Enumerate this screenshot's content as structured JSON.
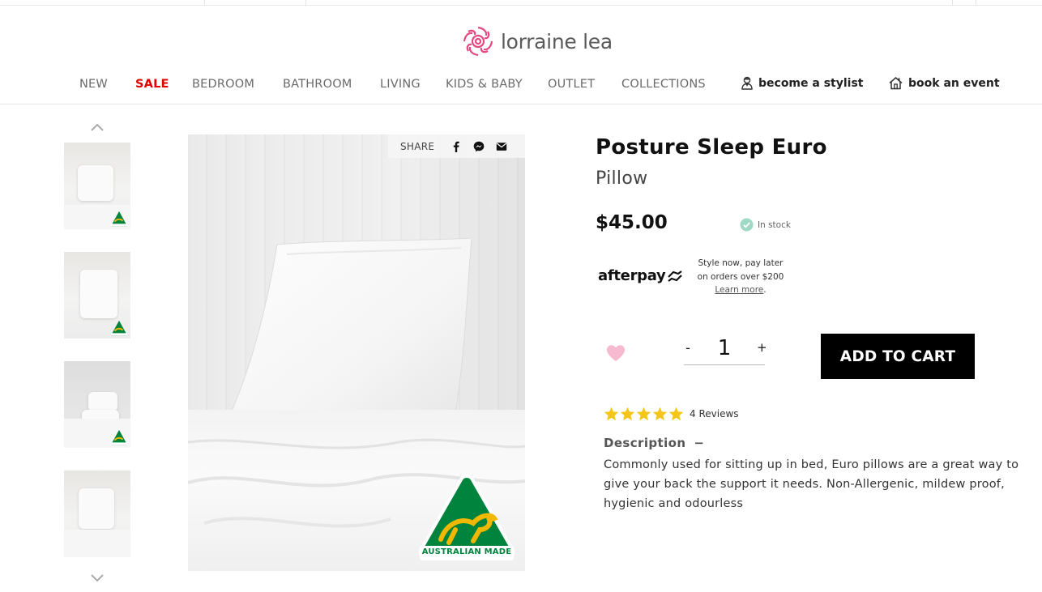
{
  "brand": {
    "name": "lorraine lea",
    "accent": "#e5467f"
  },
  "nav": {
    "items": [
      "NEW",
      "SALE",
      "BEDROOM",
      "BATHROOM",
      "LIVING",
      "KIDS & BABY",
      "OUTLET",
      "COLLECTIONS"
    ],
    "sale_color": "#e00000",
    "stylist_label": "become a stylist",
    "event_label": "book an event"
  },
  "gallery": {
    "up_icon": "chevron-up-icon",
    "down_icon": "chevron-down-icon",
    "badge_text": "AUSTRALIAN MADE"
  },
  "share": {
    "label": "SHARE",
    "icons": [
      "facebook-icon",
      "messenger-icon",
      "email-icon"
    ]
  },
  "product": {
    "title": "Posture Sleep Euro",
    "subtitle": "Pillow",
    "price": "$45.00",
    "stock": "In stock",
    "stock_color": "#9fd8c4"
  },
  "afterpay": {
    "logo": "afterpay",
    "line1": "Style now, pay later",
    "line2": "on orders over $200",
    "learn": "Learn more",
    "learn_suffix": "."
  },
  "purchase": {
    "minus": "-",
    "plus": "+",
    "quantity": "1",
    "cta": "ADD TO CART",
    "wishlist_color": "#f7b9cf"
  },
  "rating": {
    "stars": 5,
    "reviews": "4 Reviews",
    "star_color": "#f5c518"
  },
  "description": {
    "heading": "Description",
    "toggle": "−",
    "body": "Commonly used for sitting up in bed, Euro pillows are a great way to give your back the support it needs. Non-Allergenic, mildew proof, hygienic and odourless"
  }
}
